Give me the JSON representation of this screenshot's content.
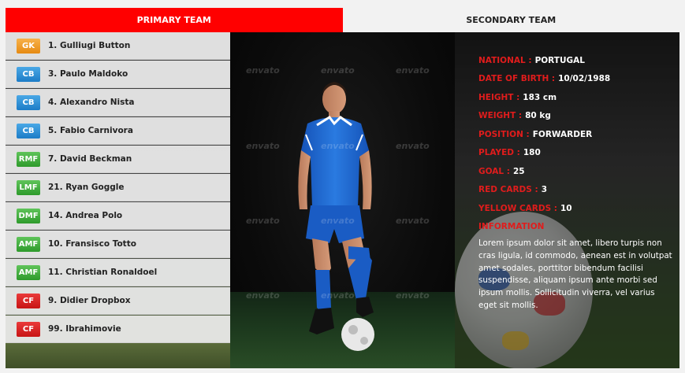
{
  "tabs": [
    {
      "label": "PRIMARY TEAM",
      "active": true
    },
    {
      "label": "SECONDARY TEAM",
      "active": false
    }
  ],
  "players": [
    {
      "pos": "GK",
      "name": "1. Gulliugi Button",
      "color": "#e68a12"
    },
    {
      "pos": "CB",
      "name": "3. Paulo Maldoko",
      "color": "#1c7cc7"
    },
    {
      "pos": "CB",
      "name": "4. Alexandro Nista",
      "color": "#1c7cc7"
    },
    {
      "pos": "CB",
      "name": "5. Fabio Carnivora",
      "color": "#1c7cc7"
    },
    {
      "pos": "RMF",
      "name": "7. David Beckman",
      "color": "#2e9a2b"
    },
    {
      "pos": "LMF",
      "name": "21. Ryan Goggle",
      "color": "#2e9a2b"
    },
    {
      "pos": "DMF",
      "name": "14. Andrea Polo",
      "color": "#2e9a2b"
    },
    {
      "pos": "AMF",
      "name": "10. Fransisco Totto",
      "color": "#2e9a2b"
    },
    {
      "pos": "AMF",
      "name": "11. Christian Ronaldoel",
      "color": "#2e9a2b"
    },
    {
      "pos": "CF",
      "name": "9. Didier Dropbox",
      "color": "#c71414"
    },
    {
      "pos": "CF",
      "name": "99. Ibrahimovie",
      "color": "#c71414"
    }
  ],
  "watermark": "envato",
  "profile": {
    "nationality": {
      "label": "NATIONAL :",
      "value": "PORTUGAL"
    },
    "dob": {
      "label": "DATE OF BIRTH :",
      "value": "10/02/1988"
    },
    "height": {
      "label": "HEIGHT :",
      "value": "183 cm"
    },
    "weight": {
      "label": "WEIGHT :",
      "value": "80 kg"
    },
    "position": {
      "label": "POSITION :",
      "value": "FORWARDER"
    },
    "played": {
      "label": "PLAYED :",
      "value": "180"
    },
    "goal": {
      "label": "GOAL :",
      "value": "25"
    },
    "red": {
      "label": "RED CARDS :",
      "value": "3"
    },
    "yellow": {
      "label": "YELLOW CARDS :",
      "value": "10"
    },
    "info_label": "INFORMATION",
    "info_text": "Lorem ipsum dolor sit amet, libero turpis non cras ligula, id commodo, aenean est in volutpat amet sodales, porttitor bibendum facilisi suspendisse, aliquam ipsum ante morbi sed ipsum mollis. Sollicitudin viverra, vel varius eget sit mollis."
  },
  "colors": {
    "accent": "#ff0000",
    "label_red": "#e01c1c",
    "kit_blue": "#1f6fd6"
  }
}
